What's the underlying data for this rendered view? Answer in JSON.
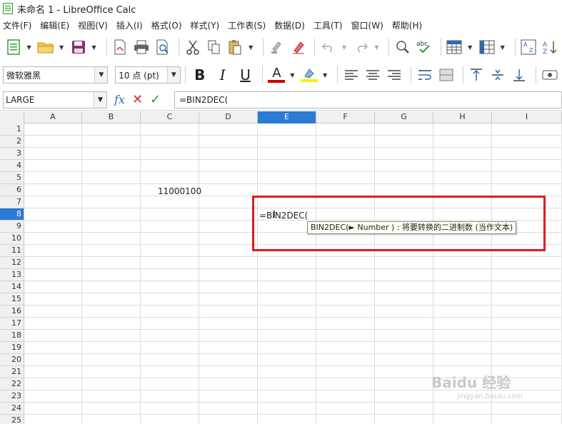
{
  "window": {
    "title": "未命名 1 - LibreOffice Calc"
  },
  "menu": [
    {
      "label": "文件(F)"
    },
    {
      "label": "编辑(E)"
    },
    {
      "label": "视图(V)"
    },
    {
      "label": "插入(I)"
    },
    {
      "label": "格式(O)"
    },
    {
      "label": "样式(Y)"
    },
    {
      "label": "工作表(S)"
    },
    {
      "label": "数据(D)"
    },
    {
      "label": "工具(T)"
    },
    {
      "label": "窗口(W)"
    },
    {
      "label": "帮助(H)"
    }
  ],
  "formatting": {
    "font_name": "微软雅黑",
    "font_size": "10 点 (pt)",
    "bold_label": "B",
    "italic_label": "I",
    "underline_label": "U",
    "font_color_label": "A",
    "font_color": "#cc0000",
    "highlight_color": "#ffee00"
  },
  "formula_bar": {
    "name_box": "LARGE",
    "formula": "=BIN2DEC("
  },
  "sheet": {
    "columns": [
      "A",
      "B",
      "C",
      "D",
      "E",
      "F",
      "G",
      "H",
      "I"
    ],
    "active_column": "E",
    "rows": [
      "1",
      "2",
      "3",
      "4",
      "5",
      "6",
      "7",
      "8",
      "9",
      "10",
      "11",
      "12",
      "13",
      "14",
      "15",
      "16",
      "17",
      "18",
      "19",
      "20",
      "21",
      "22",
      "23",
      "24",
      "25"
    ],
    "active_row": "8",
    "cells": {
      "C6": "11000100",
      "E8": "=BIN2DEC("
    }
  },
  "tooltip": {
    "text": "BIN2DEC(► Number ) : 将要转换的二进制数 (当作文本)"
  },
  "accent_color": "#2a7bd4",
  "highlight_box_color": "#e01b1b",
  "watermark": {
    "brand": "Baidu 经验",
    "sub": "jingyan.baidu.com"
  }
}
